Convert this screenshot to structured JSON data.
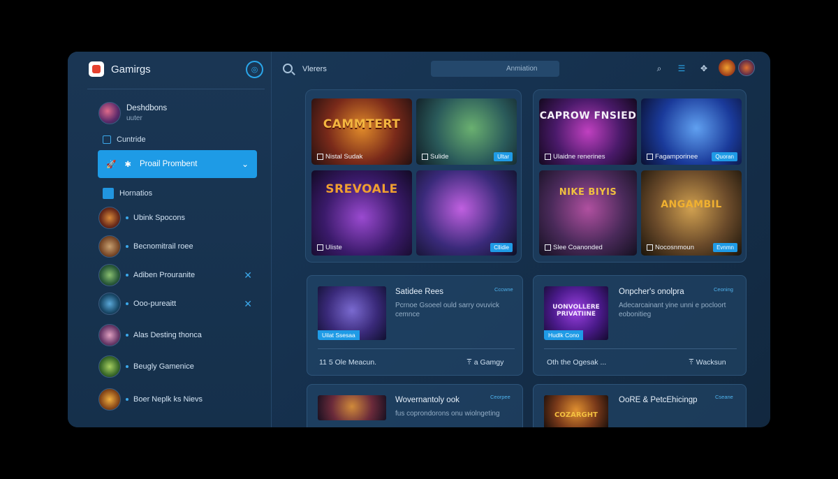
{
  "app": {
    "name": "Gamirgs"
  },
  "sidebar": {
    "profile": {
      "name": "Deshdbons",
      "sub": "uuter"
    },
    "section_label": "Cuntride",
    "promo_label": "Proail Prombent",
    "section2_label": "Hornatios",
    "friends": [
      {
        "name": "Ubink Spocons",
        "close": ""
      },
      {
        "name": "Becnomitrail roee",
        "close": ""
      },
      {
        "name": "Adiben Prouranite",
        "close": "✕"
      },
      {
        "name": "Ooo-pureaitt",
        "close": "✕"
      },
      {
        "name": "Alas Desting thonca",
        "close": ""
      },
      {
        "name": "Beugly Gamenice",
        "close": ""
      },
      {
        "name": "Boer Neplk ks Nievs",
        "close": ""
      }
    ]
  },
  "topbar": {
    "search_label": "Vlerers",
    "field_text": "Anmiation"
  },
  "tiles": [
    {
      "title": "CAMMTERT",
      "label": "Nistal Sudak",
      "badge": ""
    },
    {
      "title": "",
      "label": "Sulide",
      "badge": "Ultar"
    },
    {
      "title": "SREVOALE",
      "label": "Uliste",
      "badge": ""
    },
    {
      "title": "",
      "label": "",
      "badge": "Cllidie"
    },
    {
      "title": "CAPROW FNSIED",
      "label": "Ulaidne renerines",
      "badge": ""
    },
    {
      "title": "",
      "label": "Fagamporinee",
      "badge": "Quoran"
    },
    {
      "title": "NIKE BIYIS",
      "label": "Slee Coanonded",
      "badge": ""
    },
    {
      "title": "ANGAMBIL",
      "label": "Nocosnmoun",
      "badge": "Evnmn"
    }
  ],
  "cards": [
    {
      "title": "Satidee Rees",
      "tag": "Cccwne",
      "desc": "Pcrnoe Gsoeel ould sarry ovuvick cemnce",
      "thumb_tag": "Uilat Ssesaa",
      "thumb_title": "",
      "foot_left": "11 5 Ole Meacun.",
      "foot_right": "a Gamgy"
    },
    {
      "title": "Onpcher's onolpra",
      "tag": "Ceoning",
      "desc": "Adecarcainant yine unni e pocloort eobonitieg",
      "thumb_tag": "Hudlk Cono",
      "thumb_title": "UONVOLLERE PRIVATIINE",
      "foot_left": "Oth the Ogesak ...",
      "foot_right": "Wacksun"
    },
    {
      "title": "Wovernantoly ook",
      "tag": "Ceorpee",
      "desc": "fus coprondorons onu wiolngeting",
      "thumb_tag": "",
      "thumb_title": "",
      "foot_left": "",
      "foot_right": ""
    },
    {
      "title": "OoRE & PetcEhicingp",
      "tag": "Cseane",
      "desc": "",
      "thumb_tag": "",
      "thumb_title": "COZARGHT",
      "foot_left": "",
      "foot_right": ""
    }
  ]
}
